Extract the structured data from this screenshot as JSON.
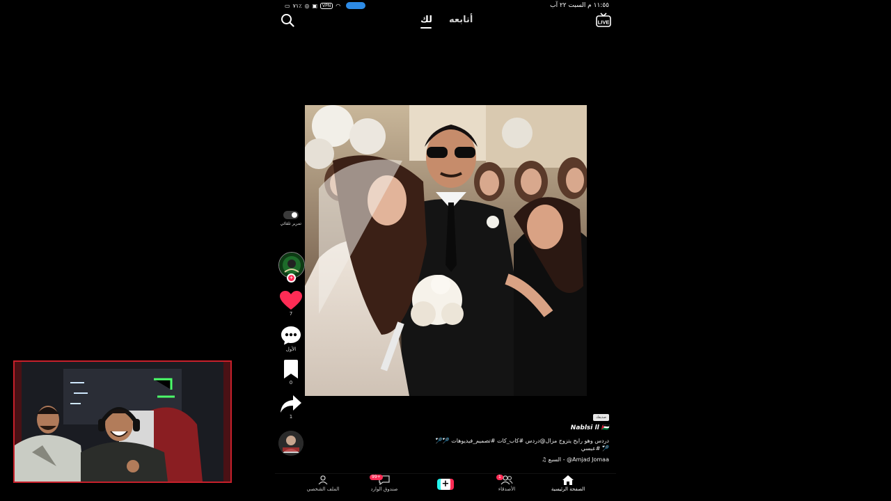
{
  "status_bar": {
    "time_date": "١١:٥٥ م  السبت ٢٢ آب",
    "battery": "٧١٪",
    "vpn": "VPN",
    "icons": [
      "cast-icon",
      "wifi-icon",
      "vpn-icon",
      "message-icon",
      "settings-icon",
      "alarm-icon",
      "battery-icon"
    ]
  },
  "top_nav": {
    "tabs": [
      {
        "label": "أتابعه",
        "active": false
      },
      {
        "label": "لك",
        "active": true
      }
    ],
    "live_label": "LIVE"
  },
  "sidebar": {
    "autoscroll_label": "تمرير تلقائي",
    "likes": "7",
    "comments": "الأول",
    "saves": "0",
    "shares": "1",
    "follow_plus": "+"
  },
  "caption": {
    "friend_tag": "صديقك",
    "author": "Nablsi ll 🇵🇸",
    "description": "دردس وهو رايح يتزوج مزال@دردس #كاب_كات #تصميم_فيديوهات 🏸🏸🏸 #عبسي",
    "sound": "Amjad Jomaa@ - السبع ♫"
  },
  "bottom_nav": {
    "home": "الصفحة الرئيسية",
    "friends": "الأصدقاء",
    "friends_badge": "1",
    "create": "+",
    "inbox": "صندوق الوارد",
    "inbox_badge": "99+",
    "profile": "الملف الشخصي"
  },
  "colors": {
    "accent_red": "#fe2c55",
    "accent_cyan": "#25f4ee",
    "cast_blue": "#2d8be6",
    "webcam_border": "#c8202b"
  }
}
